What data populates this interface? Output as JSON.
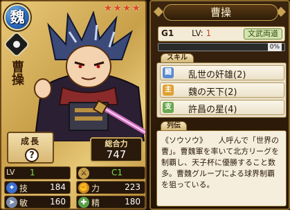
{
  "card": {
    "clan_kanji": "魏",
    "stars": "★★★★",
    "name_vertical": "曹操",
    "growth_label": "成長",
    "growth_value": "?",
    "power_label": "総合力",
    "power_value": "747"
  },
  "stats": {
    "lv_label": "LV",
    "lv_value": "1",
    "rank_value": "C1",
    "skill_label": "技",
    "skill_value": "184",
    "power_label": "力",
    "power_value": "223",
    "agility_label": "敏",
    "agility_value": "160",
    "spirit_label": "精",
    "spirit_value": "180"
  },
  "detail": {
    "title": "曹操",
    "grade": "G1",
    "lv_label": "LV:",
    "lv_value": "1",
    "trait": "文武両道",
    "exp_percent": "0%",
    "exp_fraction": 0,
    "skills_section": "スキル",
    "skills": [
      {
        "tag": "闘",
        "name": "乱世の奸雄(2)",
        "color": "#5a8ad0"
      },
      {
        "tag": "主",
        "name": "魏の天下(2)",
        "color": "#e0a030"
      },
      {
        "tag": "支",
        "name": "許昌の星(4)",
        "color": "#6aa84f"
      }
    ],
    "bio_section": "列伝",
    "bio_text": "《ソウソウ》　　人呼んで「世界の曹」。曹魏軍を率いて北方リーグを制覇し、天子杯に優勝すること数多。曹魏グループによる球界制覇を狙っている。"
  },
  "colors": {
    "gold": "#c9a04a",
    "dark": "#24160a",
    "lv_green": "#7be04c"
  }
}
